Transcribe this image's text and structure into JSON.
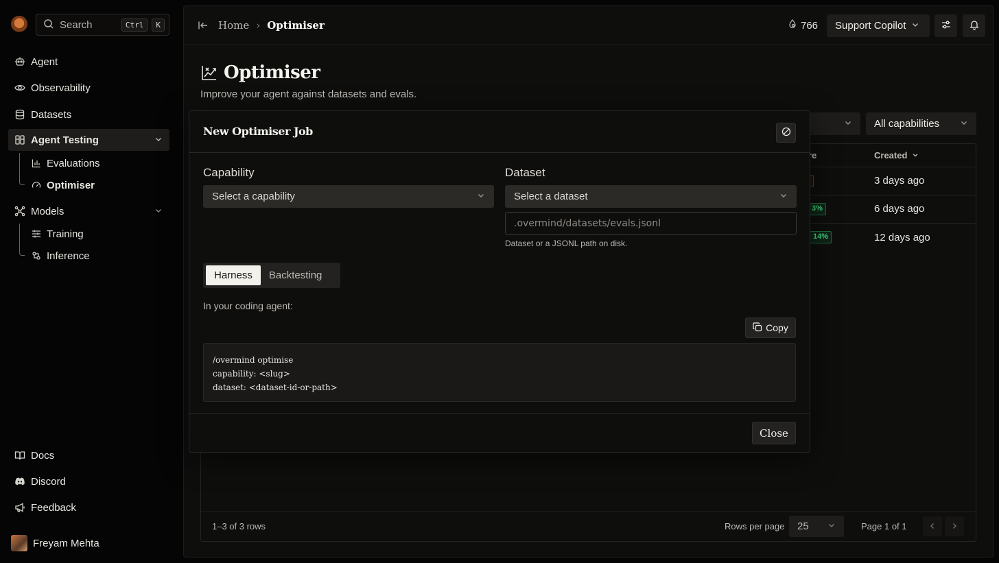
{
  "sidebar": {
    "search": {
      "label": "Search",
      "shortcut_ctrl": "Ctrl",
      "shortcut_key": "K"
    },
    "nav": [
      {
        "label": "Agent",
        "icon": "agent-icon"
      },
      {
        "label": "Observability",
        "icon": "eye-icon"
      },
      {
        "label": "Datasets",
        "icon": "database-icon"
      },
      {
        "label": "Agent Testing",
        "icon": "testing-icon"
      },
      {
        "label": "Models",
        "icon": "models-icon"
      }
    ],
    "agent_testing_children": [
      {
        "label": "Evaluations",
        "icon": "chart-icon"
      },
      {
        "label": "Optimiser",
        "icon": "gauge-icon"
      }
    ],
    "models_children": [
      {
        "label": "Training",
        "icon": "sliders-icon"
      },
      {
        "label": "Inference",
        "icon": "inference-icon"
      }
    ],
    "bottom": [
      {
        "label": "Docs",
        "icon": "book-icon"
      },
      {
        "label": "Discord",
        "icon": "discord-icon"
      },
      {
        "label": "Feedback",
        "icon": "megaphone-icon"
      }
    ],
    "user": {
      "name": "Freyam Mehta"
    }
  },
  "topbar": {
    "breadcrumb": {
      "home": "Home",
      "current": "Optimiser"
    },
    "credits": "766",
    "project": "Support Copilot"
  },
  "page": {
    "title": "Optimiser",
    "subtitle": "Improve your agent against datasets and evals.",
    "filter_capabilities": "All capabilities"
  },
  "table": {
    "headers": {
      "score_partial": "re",
      "created": "Created"
    },
    "rows": [
      {
        "score_partial": "",
        "created": "3 days ago"
      },
      {
        "score_partial": "3%",
        "created": "6 days ago"
      },
      {
        "score_partial": "14%",
        "created": "12 days ago"
      }
    ],
    "footer": {
      "count": "1–3 of 3 rows",
      "rows_per_page_label": "Rows per page",
      "rows_per_page": "25",
      "page": "Page 1 of 1"
    }
  },
  "modal": {
    "title": "New Optimiser Job",
    "capability_label": "Capability",
    "capability_placeholder": "Select a capability",
    "dataset_label": "Dataset",
    "dataset_placeholder": "Select a dataset",
    "path_placeholder": ".overmind/datasets/evals.jsonl",
    "helper": "Dataset or a JSONL path on disk.",
    "tabs": [
      "Harness",
      "Backtesting"
    ],
    "intro": "In your coding agent:",
    "copy_label": "Copy",
    "code": "/overmind optimise\ncapability: <slug>\ndataset: <dataset-id-or-path>",
    "close_label": "Close"
  }
}
